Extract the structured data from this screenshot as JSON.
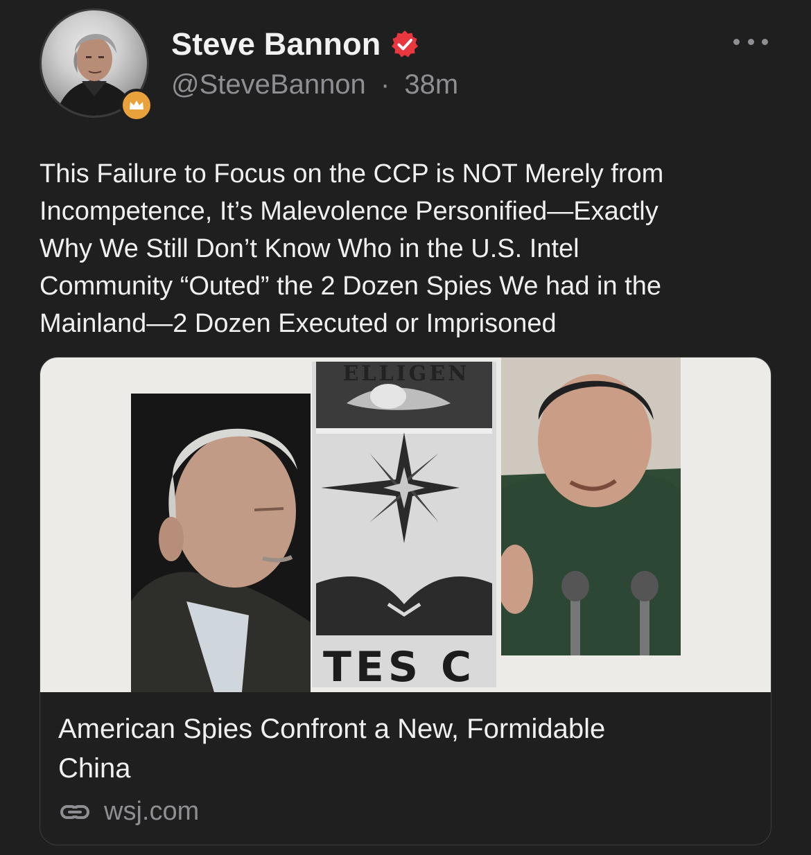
{
  "author": {
    "display_name": "Steve Bannon",
    "handle": "@SteveBannon",
    "separator": "·",
    "time": "38m"
  },
  "post": {
    "text": "This Failure to Focus on the CCP is NOT Merely from\nIncompetence, It’s Malevolence Personified—Exactly\nWhy We Still Don’t Know Who in the U.S. Intel\nCommunity “Outed” the 2 Dozen Spies We had in the\nMainland—2 Dozen Executed or Imprisoned"
  },
  "link_card": {
    "title": "American Spies Confront a New, Formidable\nChina",
    "source": "wsj.com",
    "seal_text_top": "ELLIGEN",
    "seal_text_bottom": "TES C"
  },
  "icons": {
    "verified": "verified-badge-icon",
    "more": "more-options-icon",
    "link": "link-icon",
    "badge": "crown-badge-icon"
  },
  "colors": {
    "background": "#1f1f1f",
    "verified": "#e8373f",
    "badge": "#e9a23b",
    "muted": "#8e8e93"
  }
}
